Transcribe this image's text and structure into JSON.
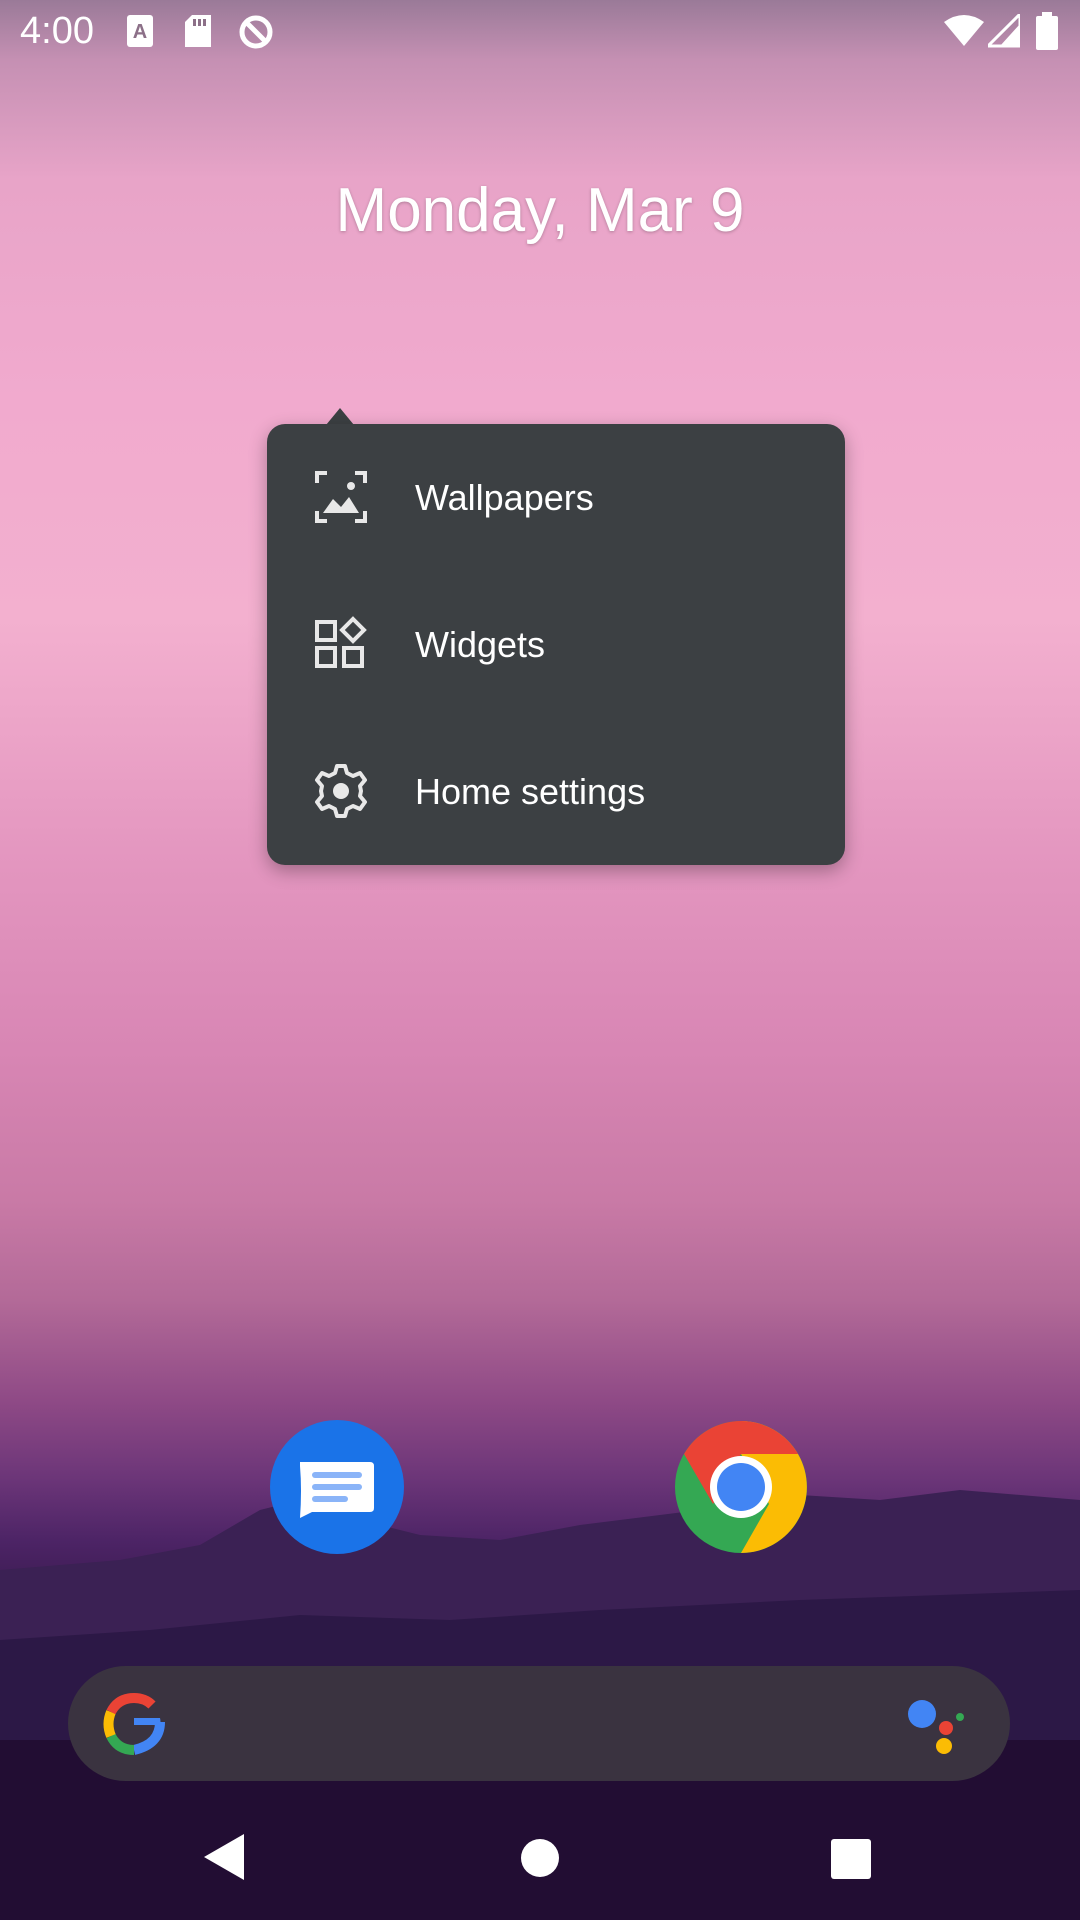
{
  "status_bar": {
    "time": "4:00",
    "left_icons": [
      "text-a-icon",
      "sd-card-icon",
      "data-saver-icon"
    ],
    "right_icons": [
      "wifi-icon",
      "signal-icon",
      "battery-icon"
    ]
  },
  "home": {
    "date": "Monday, Mar 9"
  },
  "context_menu": {
    "items": [
      {
        "label": "Wallpapers",
        "icon": "wallpaper-icon"
      },
      {
        "label": "Widgets",
        "icon": "widgets-icon"
      },
      {
        "label": "Home settings",
        "icon": "gear-icon"
      }
    ]
  },
  "dock": {
    "apps": [
      {
        "name": "messages-app-icon",
        "icon": "messages-icon"
      },
      {
        "name": "chrome-app-icon",
        "icon": "chrome-icon"
      }
    ]
  },
  "search": {
    "icons": [
      "google-g-icon",
      "google-assistant-icon"
    ]
  },
  "nav": {
    "buttons": [
      "back-icon",
      "home-icon",
      "recents-icon"
    ]
  },
  "colors": {
    "menu_bg": "#3c4043",
    "search_bg": "#3a3340",
    "messages_blue": "#1a73e8"
  }
}
